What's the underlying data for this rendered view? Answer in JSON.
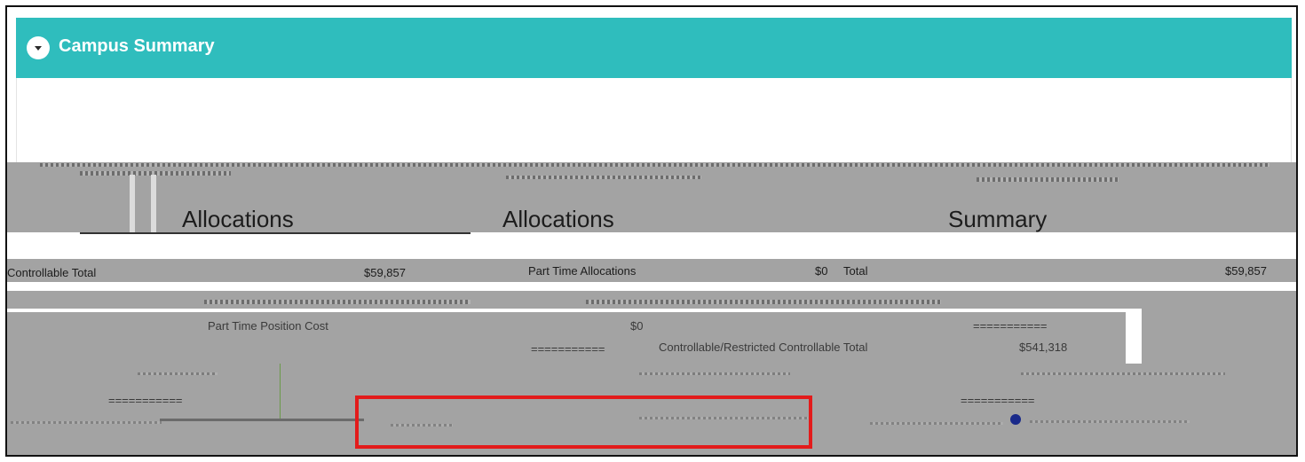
{
  "panel": {
    "title": "Campus Summary",
    "toggle_icon": "chevron-down-icon"
  },
  "headings": {
    "part_time_allocations": "Allocations",
    "controllable_allocations": "Allocations",
    "summary": "Summary"
  },
  "rows": {
    "controllable_total_label": "Controllable Total",
    "controllable_total_value": "$59,857",
    "part_time_allocations_label": "Part Time Allocations",
    "part_time_allocations_value": "$0",
    "total_label": "Total",
    "total_value": "$59,857",
    "part_time_position_cost_label": "Part Time Position Cost",
    "part_time_position_cost_value": "$0",
    "separator_a": "===========",
    "separator_b": "===========",
    "separator_c": "===========",
    "separator_d": "===========",
    "separator_e": "===========",
    "restricted_total_label": "Controllable/Restricted Controllable Total",
    "restricted_total_value": "$541,318"
  },
  "colors": {
    "header_bg": "#2fbdbd",
    "highlight_border": "#e31b1b"
  }
}
